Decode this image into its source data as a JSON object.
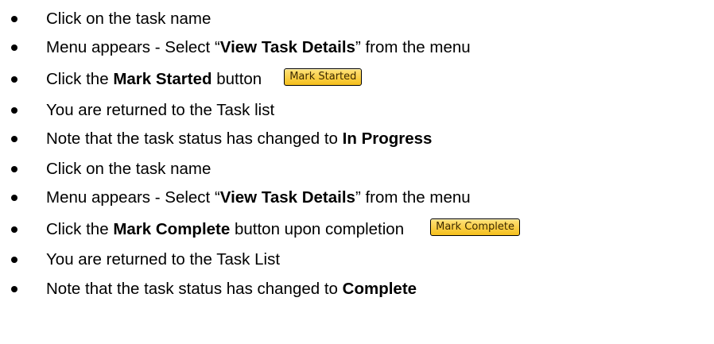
{
  "steps": [
    {
      "parts": [
        "Click on the task name"
      ]
    },
    {
      "parts": [
        "Menu appears - Select “",
        "View Task Details",
        "” from the menu"
      ]
    },
    {
      "parts": [
        "Click the ",
        "Mark Started",
        " button"
      ],
      "button_label": "Mark Started"
    },
    {
      "parts": [
        "You are returned to the Task list"
      ]
    },
    {
      "parts": [
        "Note that the task status has changed to ",
        "In Progress"
      ]
    },
    {
      "parts": [
        "Click on the task name"
      ]
    },
    {
      "parts": [
        "Menu appears - Select “",
        "View Task Details",
        "” from the menu"
      ]
    },
    {
      "parts": [
        "Click the ",
        "Mark Complete",
        " button upon completion"
      ],
      "button_label": "Mark Complete"
    },
    {
      "parts": [
        "You are returned to the Task List"
      ]
    },
    {
      "parts": [
        "Note that the task status has changed to ",
        "Complete"
      ]
    }
  ],
  "colors": {
    "button_background": "#f7c52a",
    "button_text": "#3d2a00",
    "text": "#000000"
  }
}
